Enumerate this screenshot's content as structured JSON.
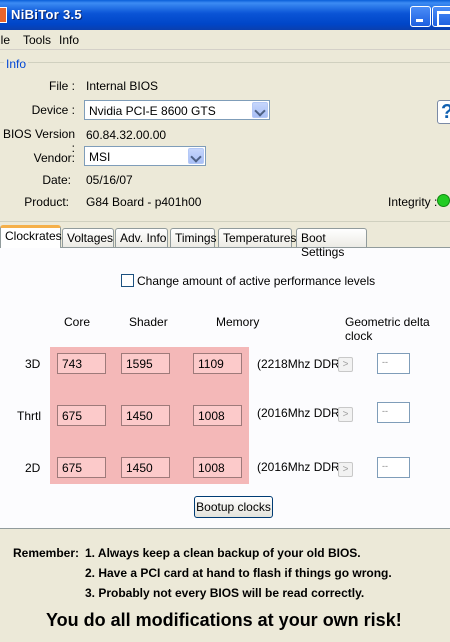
{
  "window": {
    "title": "NiBiTor 3.5"
  },
  "menu": [
    "ile",
    "Tools",
    "Info"
  ],
  "info": {
    "legend": "Info",
    "file_label": "File :",
    "file_value": "Internal BIOS",
    "device_label": "Device :",
    "device_value": "Nvidia PCI-E 8600 GTS",
    "bios_label": "BIOS Version :",
    "bios_value": "60.84.32.00.00",
    "vendor_label": "Vendor:",
    "vendor_value": "MSI",
    "date_label": "Date:",
    "date_value": "05/16/07",
    "product_label": "Product:",
    "product_value": "G84 Board - p401h00",
    "integrity_label": "Integrity :",
    "help_glyph": "?"
  },
  "tabs": [
    "Clockrates",
    "Voltages",
    "Adv. Info",
    "Timings",
    "Temperatures",
    "Boot Settings"
  ],
  "clockrates": {
    "checkbox_label": "Change amount of active performance levels",
    "checkbox_checked": false,
    "columns": [
      "Core",
      "Shader",
      "Memory",
      "Geometric delta clock"
    ],
    "rows": [
      {
        "label": "3D",
        "core": "743",
        "shader": "1595",
        "memory": "1109",
        "ddr": "(2218Mhz DDR)",
        "delta": "--"
      },
      {
        "label": "Thrtl",
        "core": "675",
        "shader": "1450",
        "memory": "1008",
        "ddr": "(2016Mhz DDR)",
        "delta": "--"
      },
      {
        "label": "2D",
        "core": "675",
        "shader": "1450",
        "memory": "1008",
        "ddr": "(2016Mhz DDR)",
        "delta": "--"
      }
    ],
    "arrow_glyph": ">",
    "bootup_button": "Bootup clocks"
  },
  "warning": {
    "remember_label": "Remember:",
    "lines": [
      "1. Always keep a clean backup of your old BIOS.",
      "2. Have a PCI card at hand to flash if things go wrong.",
      "3. Probably not every BIOS will be read correctly."
    ],
    "risk": "You do all modifications at your own risk!"
  },
  "colors": {
    "titlebar": "#0054e3",
    "legend_text": "#0046d5",
    "field_pink": "#fccaca",
    "area_pink": "#f4b8b8",
    "integrity_ok": "#22cc22",
    "active_tab_accent": "#f5b04a"
  }
}
